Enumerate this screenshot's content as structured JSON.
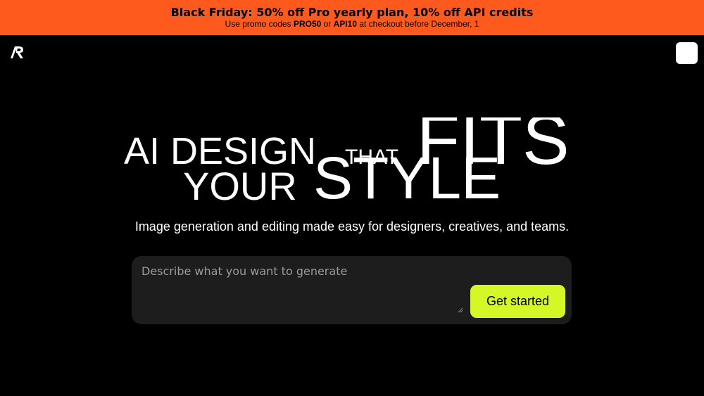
{
  "banner": {
    "title": "Black Friday: 50% off Pro yearly plan, 10% off API credits",
    "sub_prefix": "Use promo codes ",
    "code_pro": "PRO50",
    "sub_or": " or ",
    "code_api": "API10",
    "sub_suffix": " at checkout before December, 1",
    "background_color": "#fe5a1d"
  },
  "header": {
    "logo_icon": "logo-icon",
    "menu_icon": "menu-button"
  },
  "hero": {
    "word_ai_design": "AI DESIGN",
    "word_that": "THAT",
    "word_fits": "FITS",
    "word_your": "YOUR",
    "word_style": "STYLE",
    "subtitle": "Image generation and editing made easy for designers, creatives, and teams."
  },
  "prompt": {
    "placeholder": "Describe what you want to generate",
    "value": "",
    "button_label": "Get started",
    "button_color": "#d4f728"
  }
}
